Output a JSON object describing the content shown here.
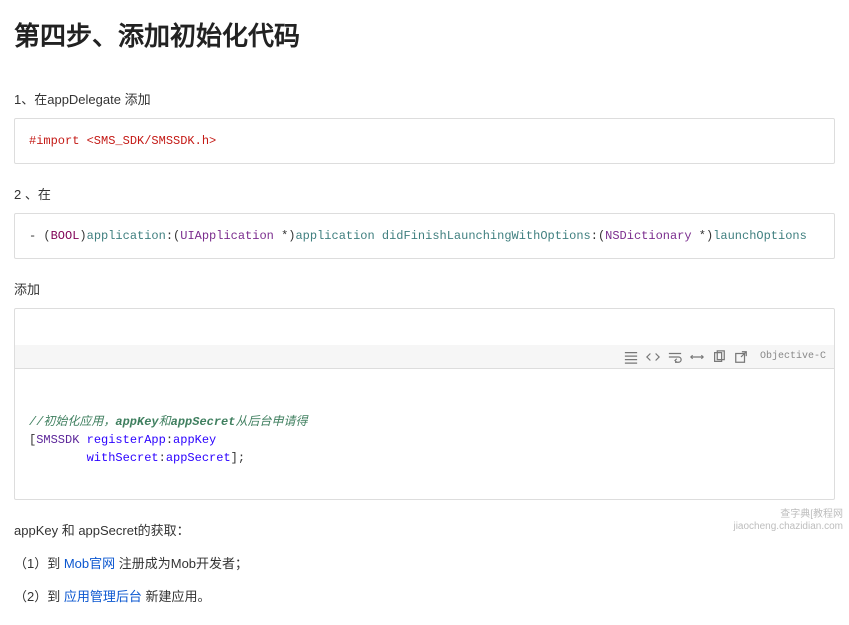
{
  "title": "第四步、添加初始化代码",
  "para1": "1、在appDelegate 添加",
  "code1": {
    "line": "#import <SMS_SDK/SMSSDK.h>"
  },
  "para2": "2 、在",
  "code2": {
    "prefix": "- (",
    "type_bool": "BOOL",
    "rparen": ")",
    "app_method": "application",
    "colon_open": ":(",
    "uiapp": "UIApplication",
    "star_close": " *)",
    "app_param": "application",
    "space": " ",
    "didFinish": "didFinishLaunchingWithOptions",
    "colon_open2": ":(",
    "nsdict": "NSDictionary",
    "star_close2": " *)",
    "launchOptions": "launchOptions"
  },
  "para3": "添加",
  "toolbar_lang": "Objective-C",
  "code3": {
    "comment_prefix": "//初始化应用，",
    "comment_appkey": "appKey",
    "comment_mid": "和",
    "comment_appsecret": "appSecret",
    "comment_suffix": "从后台申请得",
    "line2_open": "[",
    "line2_class": "SMSSDK",
    "line2_space": " ",
    "line2_registerApp": "registerApp",
    "line2_colon": ":",
    "line2_appKey": "appKey",
    "line3_pad": "        ",
    "line3_withSecret": "withSecret",
    "line3_colon": ":",
    "line3_appSecret": "appSecret",
    "line3_close": "];"
  },
  "para4": "appKey 和 appSecret的获取：",
  "bullet1_prefix": "（1）到 ",
  "bullet1_link": "Mob官网",
  "bullet1_suffix": " 注册成为Mob开发者；",
  "bullet2_prefix": "（2）到 ",
  "bullet2_link": "应用管理后台",
  "bullet2_suffix": " 新建应用。",
  "watermark_line1": "查字典[教程网",
  "watermark_line2": "jiaocheng.chazidian.com"
}
